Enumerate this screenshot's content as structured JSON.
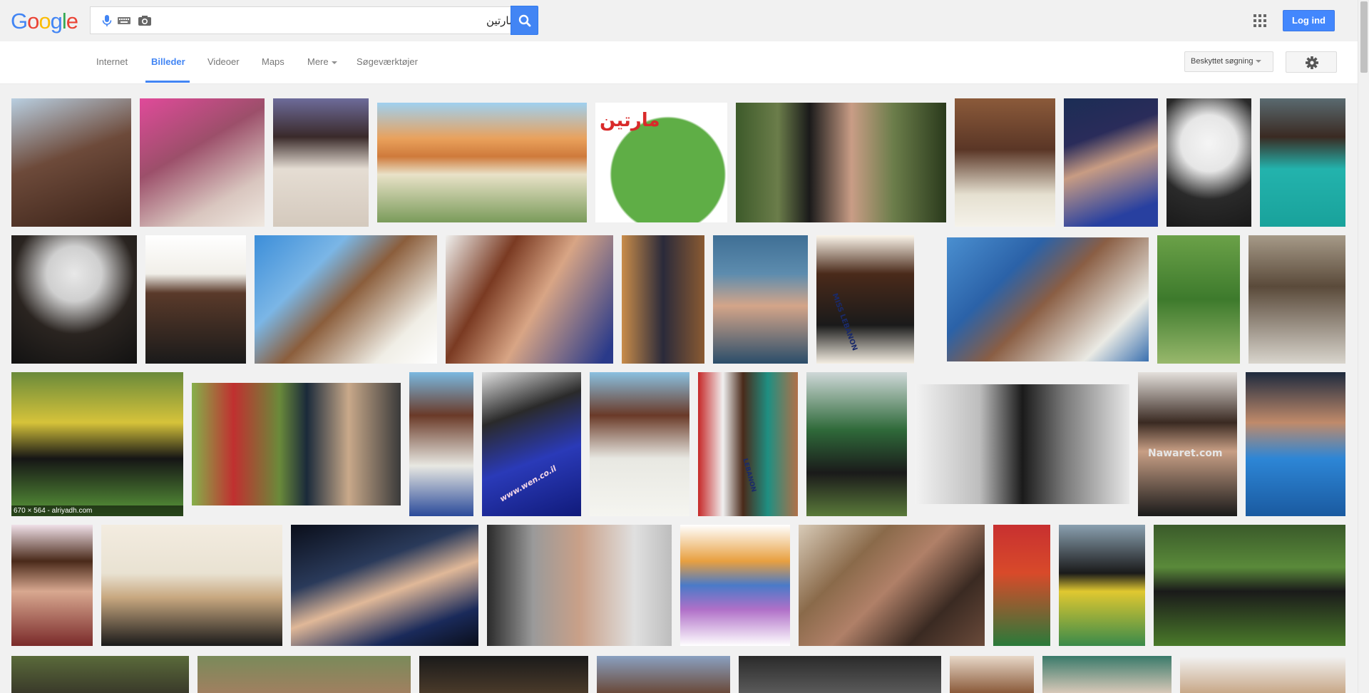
{
  "header": {
    "logo_letters": [
      "G",
      "o",
      "o",
      "g",
      "l",
      "e"
    ],
    "logo_colors": [
      "#4285f4",
      "#ea4335",
      "#fbbc05",
      "#4285f4",
      "#34a853",
      "#ea4335"
    ],
    "search_value": "مارتين",
    "login_label": "Log ind"
  },
  "nav": {
    "tabs": [
      {
        "label": "Internet"
      },
      {
        "label": "Billeder"
      },
      {
        "label": "Videoer"
      },
      {
        "label": "Maps"
      },
      {
        "label": "Mere"
      },
      {
        "label": "Søgeværktøjer"
      }
    ],
    "safe_search_label": "Beskyttet søgning",
    "accent": "#4285f4"
  },
  "results": {
    "hover_caption": "670 × 564 - alriyadh.com",
    "overlay_cartoon_title": "مارتين",
    "overlay_watermark_1": "www.wen.co.il",
    "overlay_watermark_2": "Nawaret.com",
    "overlay_sash_1": "MISS LEBANON",
    "overlay_sash_2": "LEBANON"
  }
}
